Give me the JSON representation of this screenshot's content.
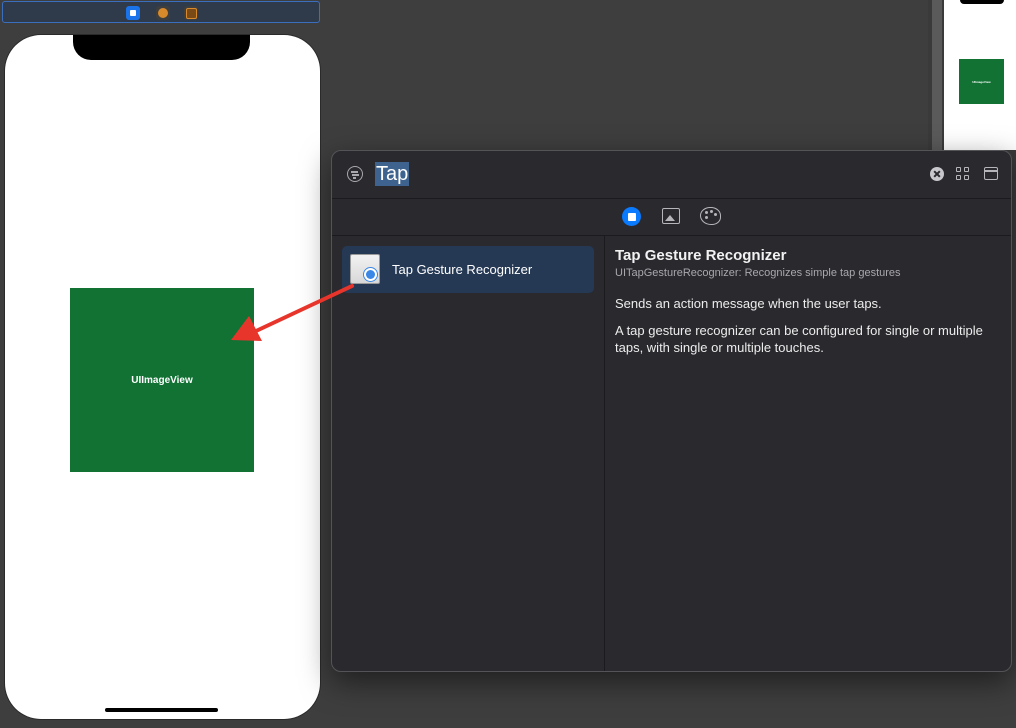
{
  "canvas": {
    "image_view_label": "UIImageView",
    "preview_label": "UIImageView"
  },
  "library": {
    "search_query": "Tap",
    "tabs": [
      {
        "name": "views",
        "icon": "square-circle-icon",
        "active": true
      },
      {
        "name": "media",
        "icon": "photo-icon",
        "active": false
      },
      {
        "name": "colors",
        "icon": "palette-icon",
        "active": false
      }
    ],
    "items": [
      {
        "label": "Tap Gesture Recognizer",
        "selected": true
      }
    ],
    "detail": {
      "title": "Tap Gesture Recognizer",
      "subtitle": "UITapGestureRecognizer: Recognizes simple tap gestures",
      "paragraph1": "Sends an action message when the user taps.",
      "paragraph2": "A tap gesture recognizer can be configured for single or multiple taps, with single or multiple touches."
    }
  },
  "colors": {
    "canvas_bg": "#3e3e3e",
    "image_view": "#117234",
    "selection": "#253955",
    "accent": "#0a7aff",
    "arrow": "#e8352b"
  }
}
